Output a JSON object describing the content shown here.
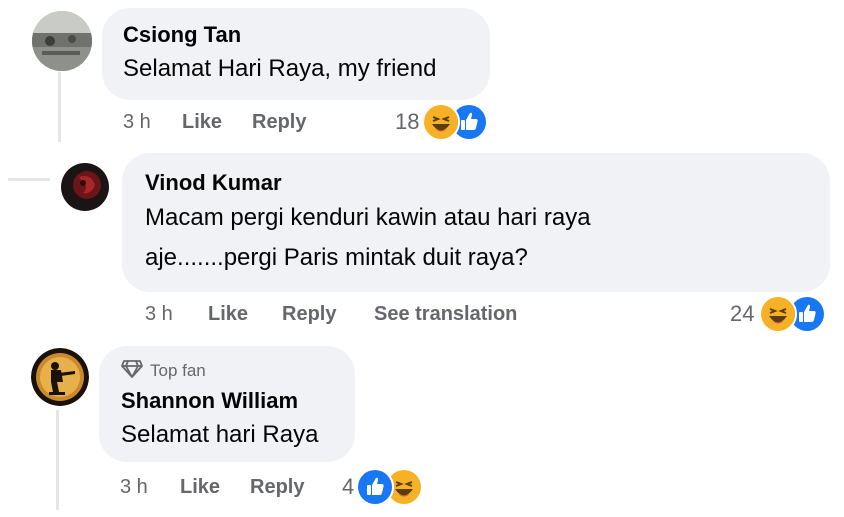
{
  "comments": [
    {
      "author": "Csiong Tan",
      "text_lines": [
        "Selamat Hari Raya, my friend"
      ],
      "time": "3 h",
      "like_label": "Like",
      "reply_label": "Reply",
      "reaction_count": "18",
      "reactions": [
        "haha-icon",
        "like-icon"
      ]
    },
    {
      "author": "Vinod Kumar",
      "text_lines": [
        "Macam pergi kenduri kawin atau hari raya",
        "aje.......pergi Paris mintak duit raya?"
      ],
      "time": "3 h",
      "like_label": "Like",
      "reply_label": "Reply",
      "translate_label": "See translation",
      "reaction_count": "24",
      "reactions": [
        "haha-icon",
        "like-icon"
      ]
    },
    {
      "badge": "Top fan",
      "author": "Shannon William",
      "text_lines": [
        "Selamat hari Raya"
      ],
      "time": "3 h",
      "like_label": "Like",
      "reply_label": "Reply",
      "reaction_count": "4",
      "reactions": [
        "like-icon",
        "haha-icon"
      ]
    }
  ],
  "colors": {
    "bubble": "#f0f2f5",
    "meta_text": "#65676b",
    "like_blue": "#1877f2",
    "haha_yellow": "#f7b125",
    "thread_line": "#e4e6eb"
  }
}
